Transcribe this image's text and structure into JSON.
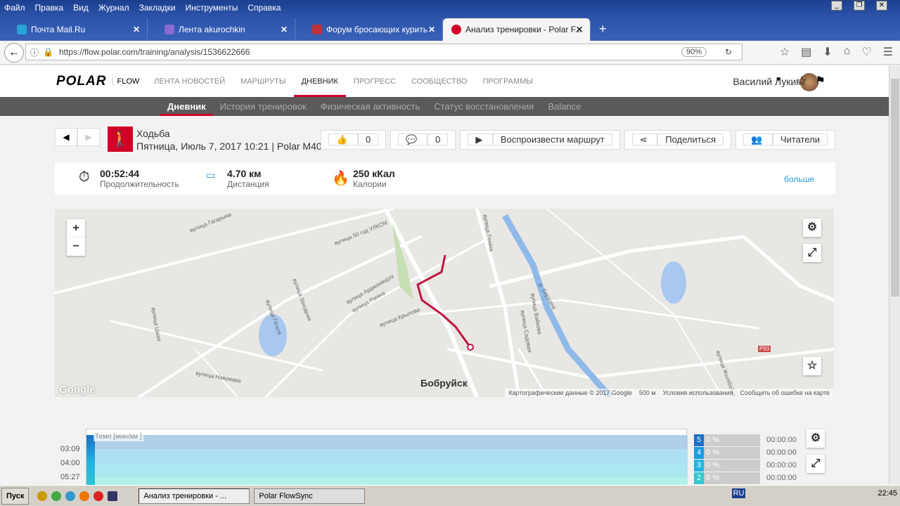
{
  "browser": {
    "menu": [
      "Файл",
      "Правка",
      "Вид",
      "Журнал",
      "Закладки",
      "Инструменты",
      "Справка"
    ],
    "tabs": [
      {
        "label": "Почта Mail.Ru",
        "color": "#2aa3d8"
      },
      {
        "label": "Лента akurochkin",
        "color": "#8a6ad0"
      },
      {
        "label": "Форум бросающих курить",
        "color": "#c0303a"
      },
      {
        "label": "Анализ тренировки - Polar F...",
        "color": "#d10027"
      }
    ],
    "url": "https://flow.polar.com/training/analysis/1536622666",
    "zoom": "90%"
  },
  "site": {
    "logo": "POLAR",
    "flow": "FLOW",
    "nav": [
      "ЛЕНТА НОВОСТЕЙ",
      "МАРШРУТЫ",
      "ДНЕВНИК",
      "ПРОГРЕСС",
      "СООБЩЕСТВО",
      "ПРОГРАММЫ"
    ],
    "active_nav": "ДНЕВНИК",
    "user": "Василий Лукин",
    "subnav": [
      "Дневник",
      "История тренировок",
      "Физическая активность",
      "Статус восстановления",
      "Balance"
    ]
  },
  "training": {
    "sport": "Ходьба",
    "subtitle": "Пятница, Июль 7, 2017 10:21 | Polar M400",
    "likes": "0",
    "comments": "0",
    "replay": "Воспроизвести маршрут",
    "share": "Поделиться",
    "readers": "Читатели"
  },
  "summary": {
    "duration": "00:52:44",
    "duration_label": "Продолжительность",
    "distance": "4.70 км",
    "distance_label": "Дистанция",
    "calories": "250 кКал",
    "calories_label": "Калории",
    "more": "больше"
  },
  "map": {
    "city": "Бобруйск",
    "google": "Google",
    "data": "Картографические данные © 2017 Google",
    "scale": "500 м",
    "terms": "Условия использования",
    "report": "Сообщить об ошибке на карте",
    "streets": [
      "вулица Гагарына",
      "вулица 50 год УЛКСМ",
      "вулица Арджанікідзэ",
      "вулица Рэпіна",
      "вулица Крылова",
      "вулица Заходняя",
      "вулица Гогаля",
      "вулица Цікая",
      "вулица Навумава",
      "вулица Леніна",
      "вулица Садовая",
      "вулица Вайкова",
      "р. Бярэзіна",
      "Р93",
      "вулица Жылібоўка"
    ]
  },
  "chart": {
    "label": "Темп [мин/км ]",
    "yticks": [
      "03:09",
      "04:00",
      "05:27"
    ],
    "zones": [
      {
        "n": "5",
        "pct": "0 %",
        "time": "00:00:00",
        "color": "#1a6fc4"
      },
      {
        "n": "4",
        "pct": "0 %",
        "time": "00:00:00",
        "color": "#1a9be0"
      },
      {
        "n": "3",
        "pct": "0 %",
        "time": "00:00:00",
        "color": "#22b5e0"
      },
      {
        "n": "2",
        "pct": "0 %",
        "time": "00:00:00",
        "color": "#34c8d0"
      }
    ]
  },
  "taskbar": {
    "start": "Пуск",
    "windows": [
      "Анализ тренировки - ...",
      "Polar FlowSync"
    ],
    "lang": "RU",
    "clock": "22:45"
  }
}
